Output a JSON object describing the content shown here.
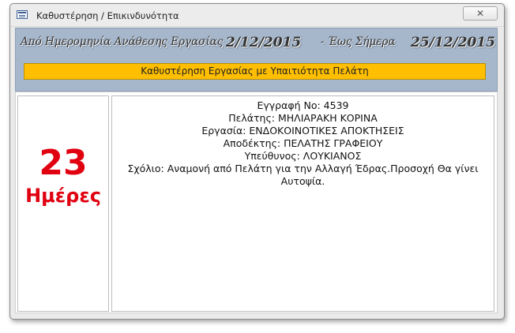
{
  "window": {
    "title": "Καθυστέρηση / Επικινδυνότητα",
    "close_label": "✕"
  },
  "header": {
    "from_label": "Από Ημερομηνία Ανάθεσης Εργασίας",
    "from_date": "2/12/2015",
    "to_label": "- Έως Σήμερα",
    "to_date": "25/12/2015",
    "banner": "Καθυστέρηση Εργασίας με Υπαιτιότητα Πελάτη"
  },
  "delay": {
    "days": "23",
    "unit": "Ημέρες"
  },
  "record": {
    "entry": "Εγγραφή Νο: 4539",
    "client": "Πελάτης: ΜΗΛΙΑΡΑΚΗ ΚΟΡΙΝΑ",
    "task": "Εργασία: ΕΝΔΟΚΟΙΝΟΤΙΚΕΣ ΑΠΟΚΤΗΣΕΙΣ",
    "recipient": "Αποδέκτης: ΠΕΛΑΤΗΣ ΓΡΑΦΕΙΟΥ",
    "responsible": "Υπεύθυνος: ΛΟΥΚΙΑΝΟΣ",
    "comment": "Σχόλιο: Αναμονή από Πελάτη για την Αλλαγή Έδρας.Προσοχή Θα γίνει Αυτοψία."
  },
  "colors": {
    "header_band": "#a6b7cc",
    "banner": "#ffbf00",
    "days_text": "#e0000f"
  },
  "icons": {
    "window_icon": "form-icon",
    "close": "close-icon"
  }
}
